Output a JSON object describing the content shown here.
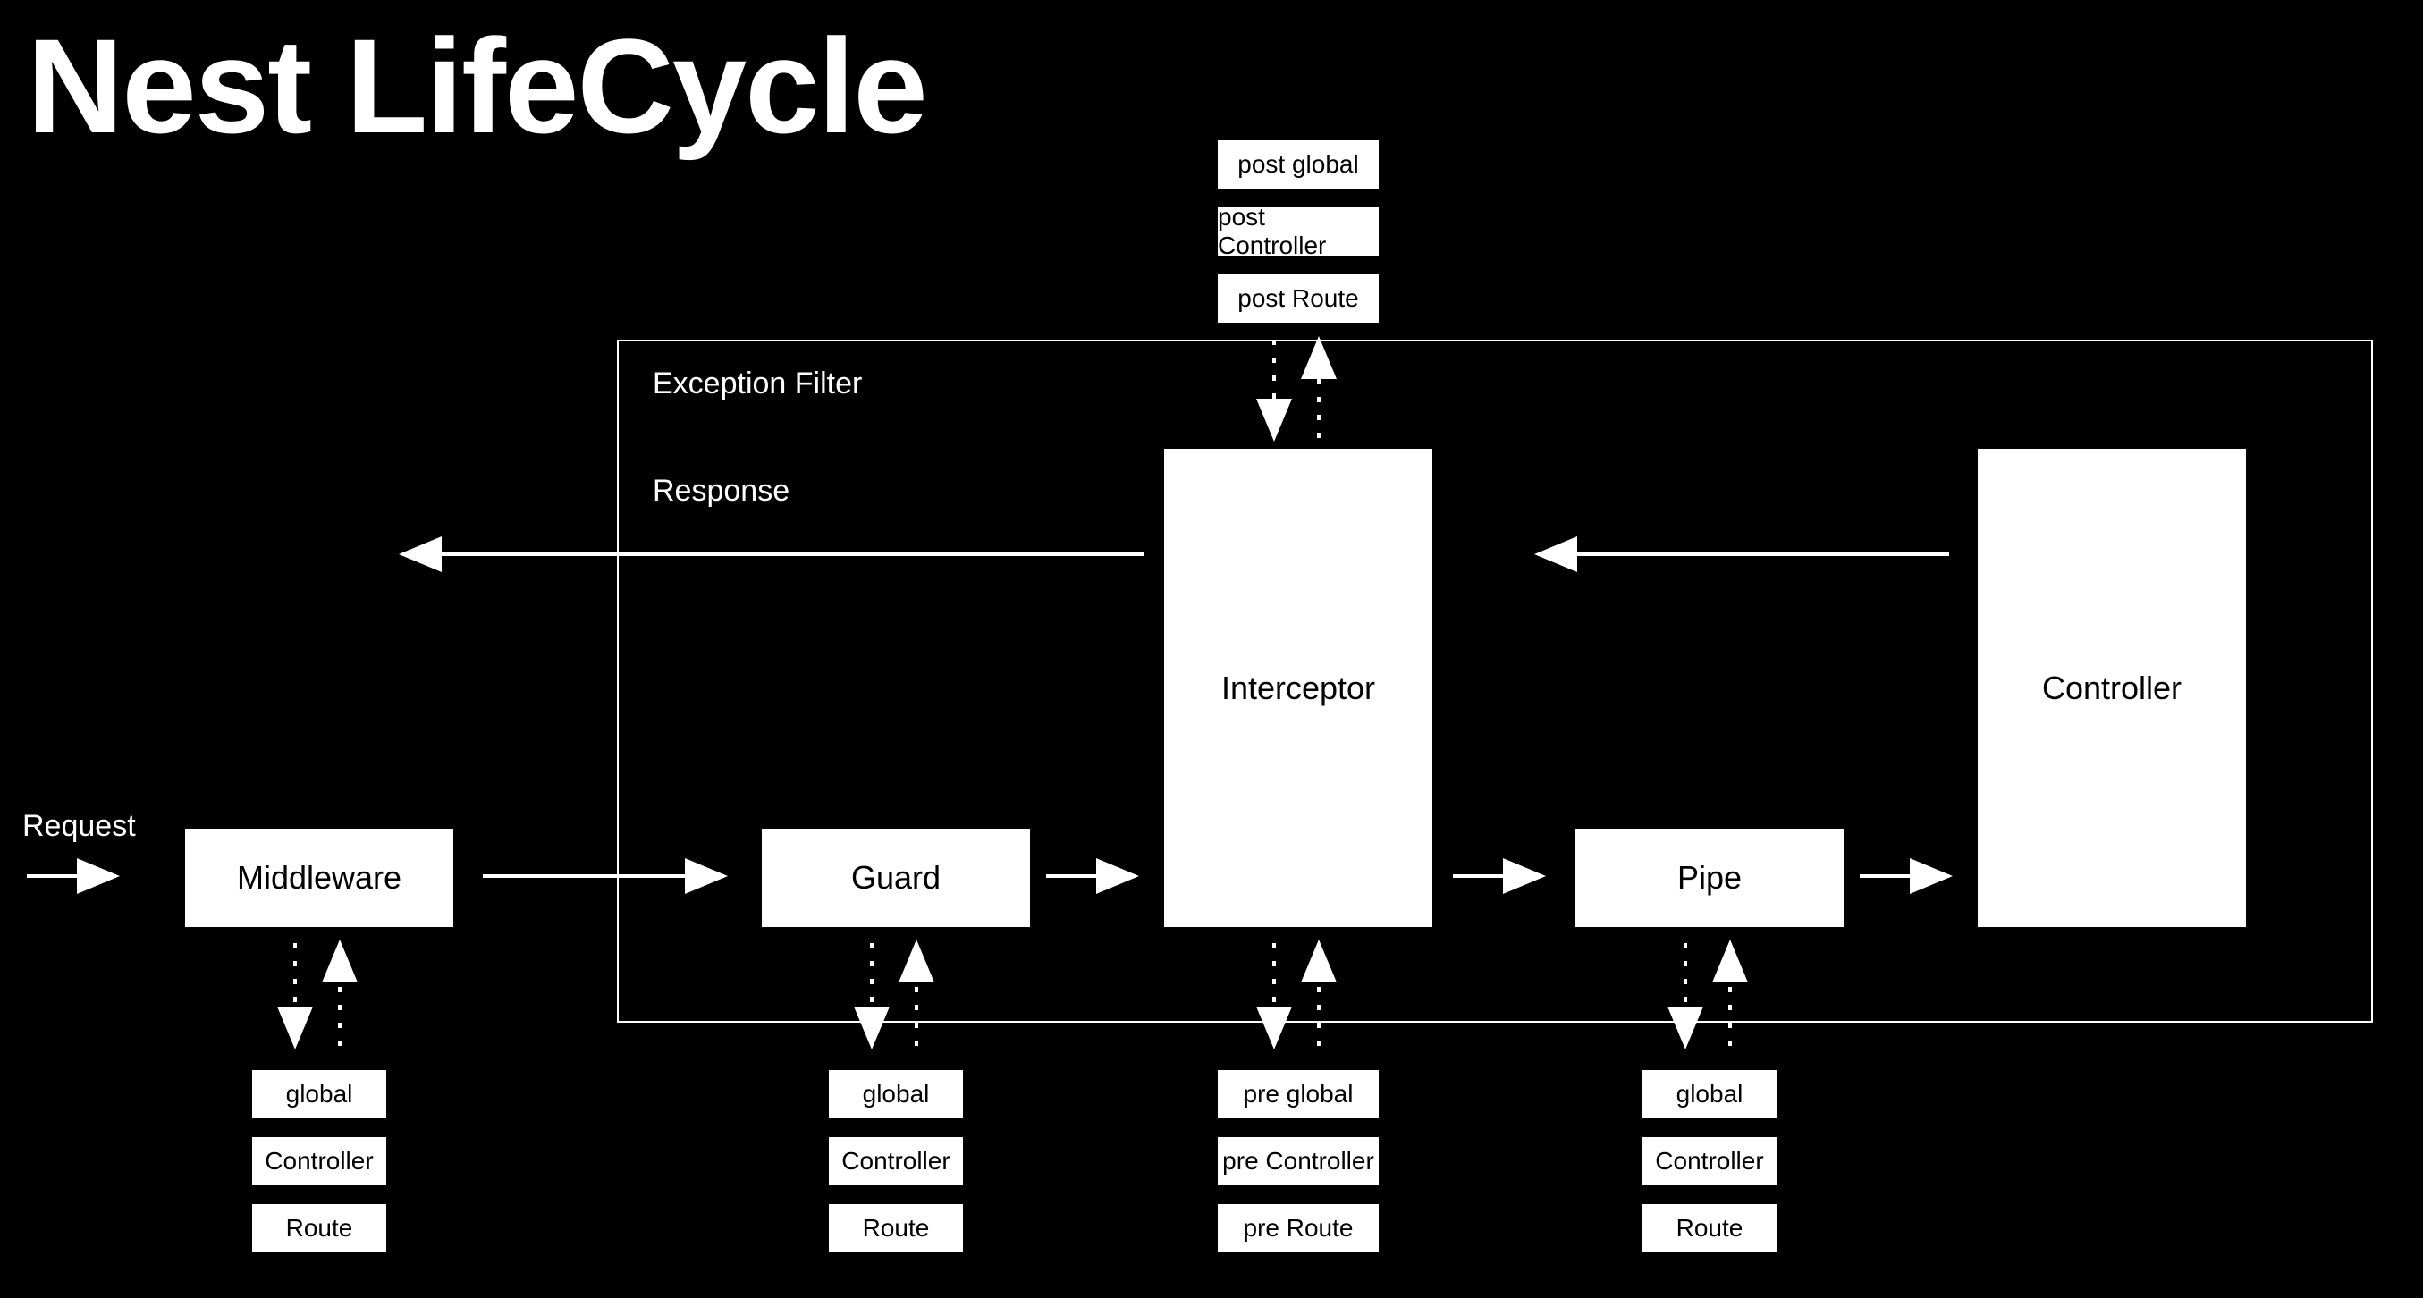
{
  "title": "Nest LifeCycle",
  "labels": {
    "request": "Request",
    "response": "Response",
    "exceptionFilter": "Exception Filter"
  },
  "nodes": {
    "middleware": "Middleware",
    "guard": "Guard",
    "interceptor": "Interceptor",
    "pipe": "Pipe",
    "controller": "Controller"
  },
  "scopes": {
    "global": "global",
    "controller": "Controller",
    "route": "Route",
    "preGlobal": "pre global",
    "preController": "pre Controller",
    "preRoute": "pre Route",
    "postGlobal": "post global",
    "postController": "post Controller",
    "postRoute": "post Route"
  }
}
